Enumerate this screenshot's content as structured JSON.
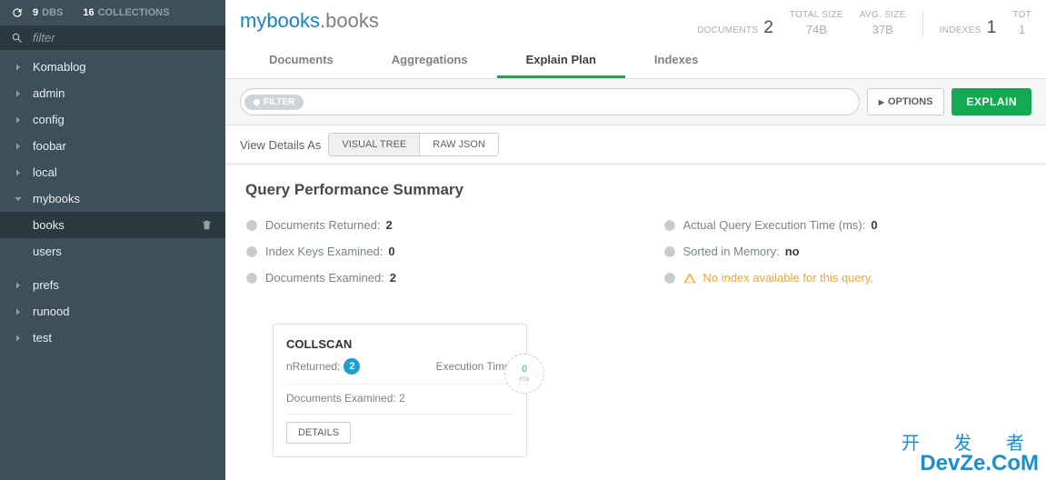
{
  "sidebar": {
    "dbs_count": "9",
    "dbs_label": "DBS",
    "coll_count": "16",
    "coll_label": "COLLECTIONS",
    "filter_placeholder": "filter",
    "items": [
      {
        "label": "Komablog",
        "expanded": false
      },
      {
        "label": "admin",
        "expanded": false
      },
      {
        "label": "config",
        "expanded": false
      },
      {
        "label": "foobar",
        "expanded": false
      },
      {
        "label": "local",
        "expanded": false
      },
      {
        "label": "mybooks",
        "expanded": true,
        "children": [
          {
            "label": "books",
            "active": true
          },
          {
            "label": "users",
            "active": false
          }
        ]
      },
      {
        "label": "prefs",
        "expanded": false
      },
      {
        "label": "runood",
        "expanded": false
      },
      {
        "label": "test",
        "expanded": false
      }
    ]
  },
  "header": {
    "db": "mybooks",
    "coll": ".books",
    "stats": {
      "documents_label": "DOCUMENTS",
      "documents_val": "2",
      "total_size_label": "TOTAL SIZE",
      "total_size_val": "74B",
      "avg_size_label": "AVG. SIZE",
      "avg_size_val": "37B",
      "indexes_label": "INDEXES",
      "indexes_val": "1",
      "tot_label": "TOT",
      "tot_val": "1"
    }
  },
  "tabs": {
    "documents": "Documents",
    "aggregations": "Aggregations",
    "explain": "Explain Plan",
    "indexes": "Indexes"
  },
  "toolbar": {
    "filter_label": "FILTER",
    "options": "OPTIONS",
    "explain": "EXPLAIN"
  },
  "view": {
    "label": "View Details As",
    "visual": "VISUAL TREE",
    "raw": "RAW JSON"
  },
  "qps": {
    "title": "Query Performance Summary",
    "docs_returned_label": "Documents Returned:",
    "docs_returned_val": "2",
    "keys_examined_label": "Index Keys Examined:",
    "keys_examined_val": "0",
    "docs_examined_label": "Documents Examined:",
    "docs_examined_val": "2",
    "exec_time_label": "Actual Query Execution Time (ms):",
    "exec_time_val": "0",
    "sorted_label": "Sorted in Memory:",
    "sorted_val": "no",
    "warn": "No index available for this query."
  },
  "stage": {
    "title": "COLLSCAN",
    "nreturned_label": "nReturned:",
    "nreturned_val": "2",
    "exec_label": "Execution Time:",
    "clock_val": "0",
    "clock_unit": "ms",
    "docs_ex_label": "Documents Examined: 2",
    "details": "DETAILS"
  },
  "watermark": {
    "line1": "开 发 者",
    "line2": "DevZe.CoM"
  }
}
